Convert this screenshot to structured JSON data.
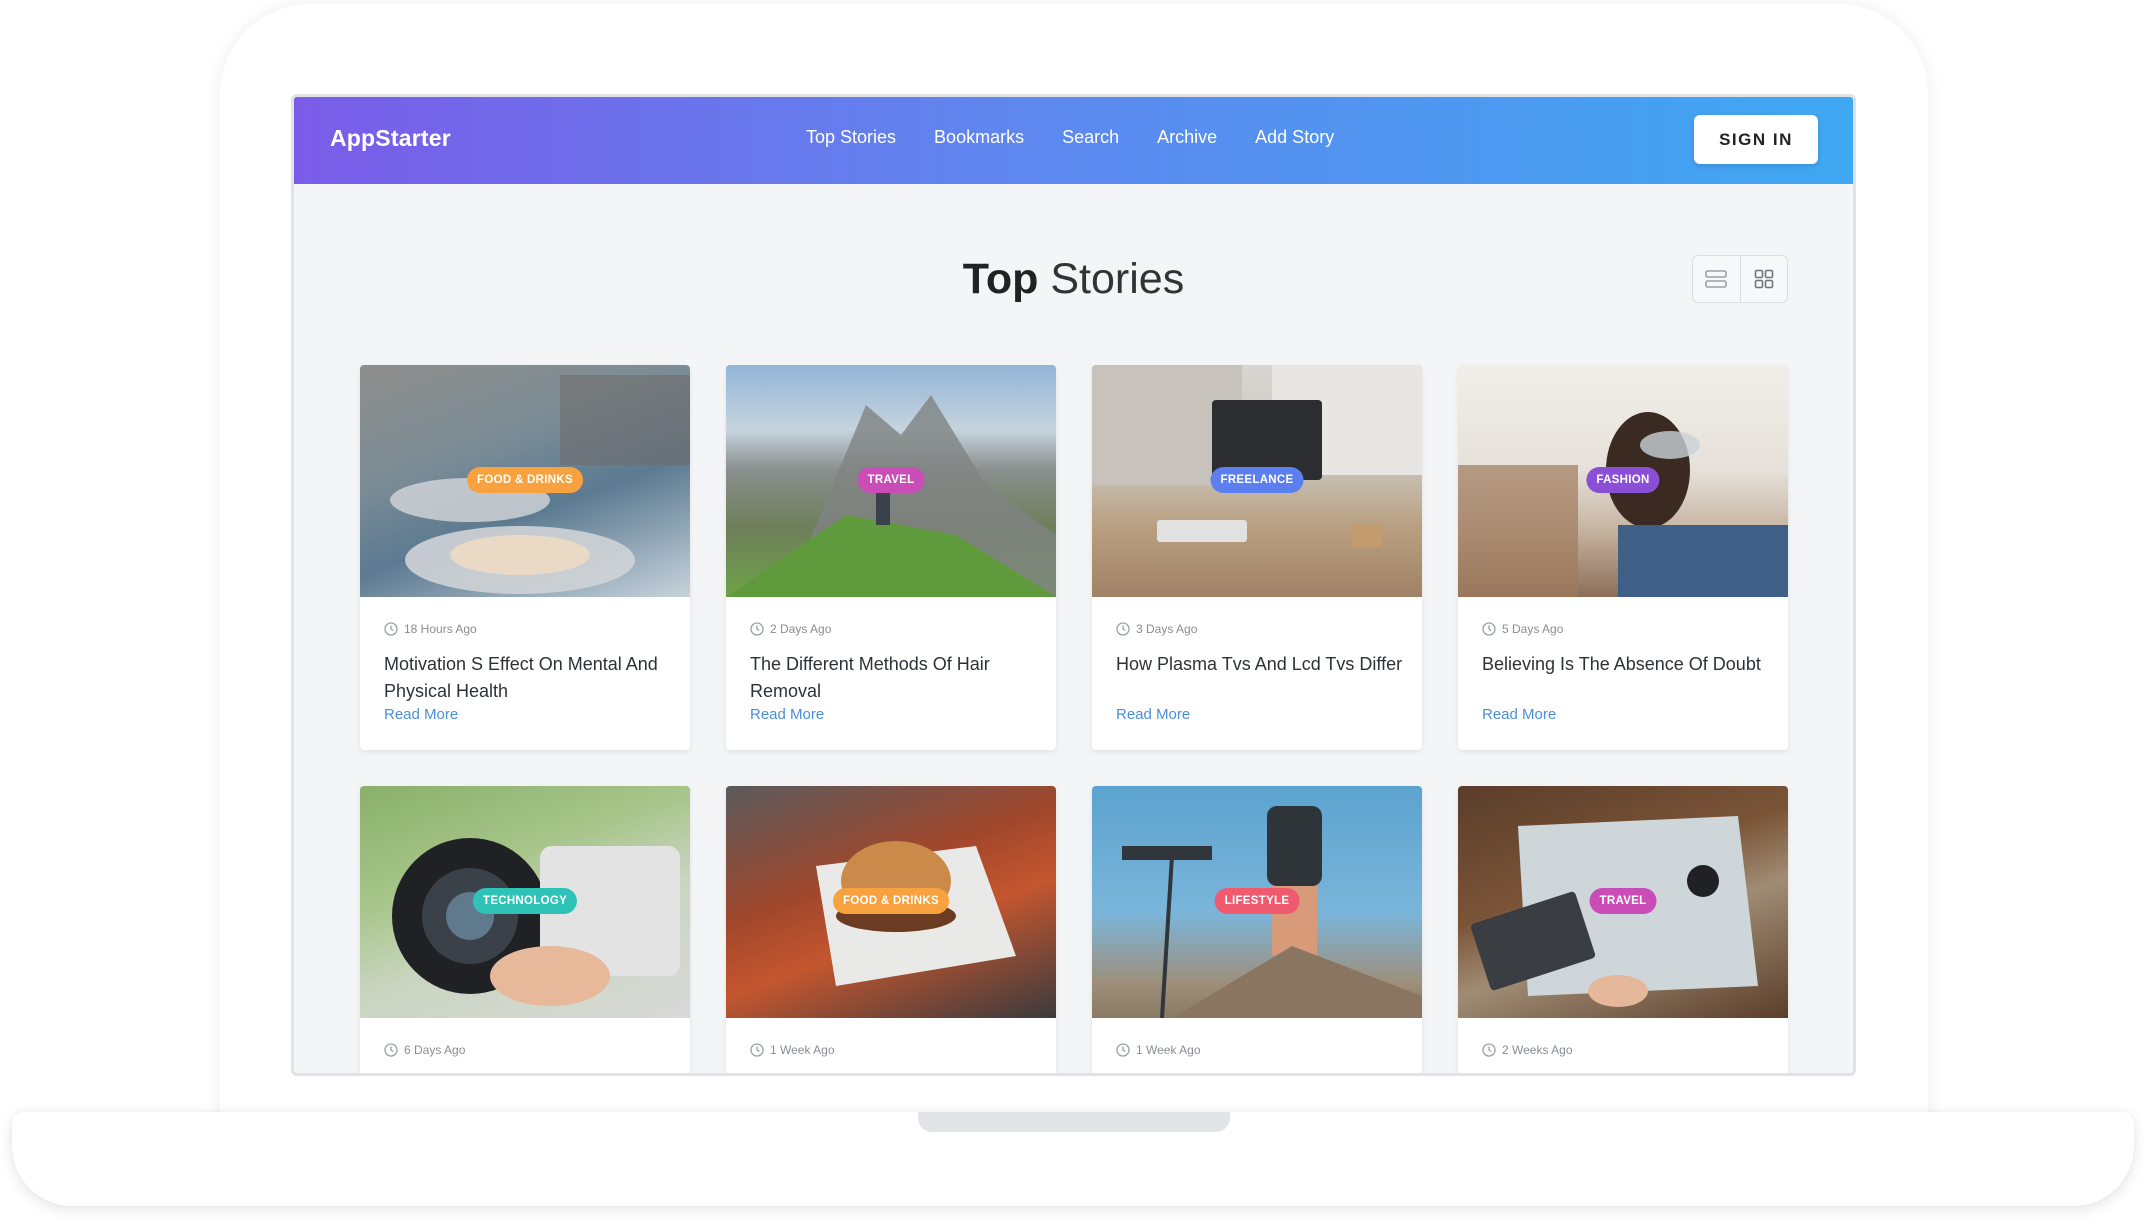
{
  "brand": "AppStarter",
  "nav": {
    "links": [
      "Top Stories",
      "Bookmarks",
      "Search",
      "Archive",
      "Add Story"
    ],
    "signin_label": "SIGN IN"
  },
  "page": {
    "title_strong": "Top",
    "title_light": "Stories",
    "view_icons": [
      "list-view-icon",
      "grid-view-icon"
    ]
  },
  "cards": [
    {
      "category": "FOOD & DRINKS",
      "badge_color": "#f8a13f",
      "time": "18 Hours Ago",
      "title": "Motivation S Effect On Mental And Physical Health",
      "read_more": "Read More"
    },
    {
      "category": "TRAVEL",
      "badge_color": "#c94cb7",
      "time": "2 Days Ago",
      "title": "The Different Methods Of Hair Removal",
      "read_more": "Read More"
    },
    {
      "category": "FREELANCE",
      "badge_color": "#5c7ff0",
      "time": "3 Days Ago",
      "title": "How Plasma Tvs And Lcd Tvs Differ",
      "read_more": "Read More"
    },
    {
      "category": "FASHION",
      "badge_color": "#8a4fd6",
      "time": "5 Days Ago",
      "title": "Believing Is The Absence Of Doubt",
      "read_more": "Read More"
    },
    {
      "category": "TECHNOLOGY",
      "badge_color": "#2fc3b8",
      "time": "6 Days Ago",
      "title": "",
      "read_more": ""
    },
    {
      "category": "FOOD & DRINKS",
      "badge_color": "#f8a13f",
      "time": "1 Week Ago",
      "title": "",
      "read_more": ""
    },
    {
      "category": "LIFESTYLE",
      "badge_color": "#ef5a6f",
      "time": "1 Week Ago",
      "title": "",
      "read_more": ""
    },
    {
      "category": "TRAVEL",
      "badge_color": "#c94cb7",
      "time": "2 Weeks Ago",
      "title": "",
      "read_more": ""
    }
  ]
}
